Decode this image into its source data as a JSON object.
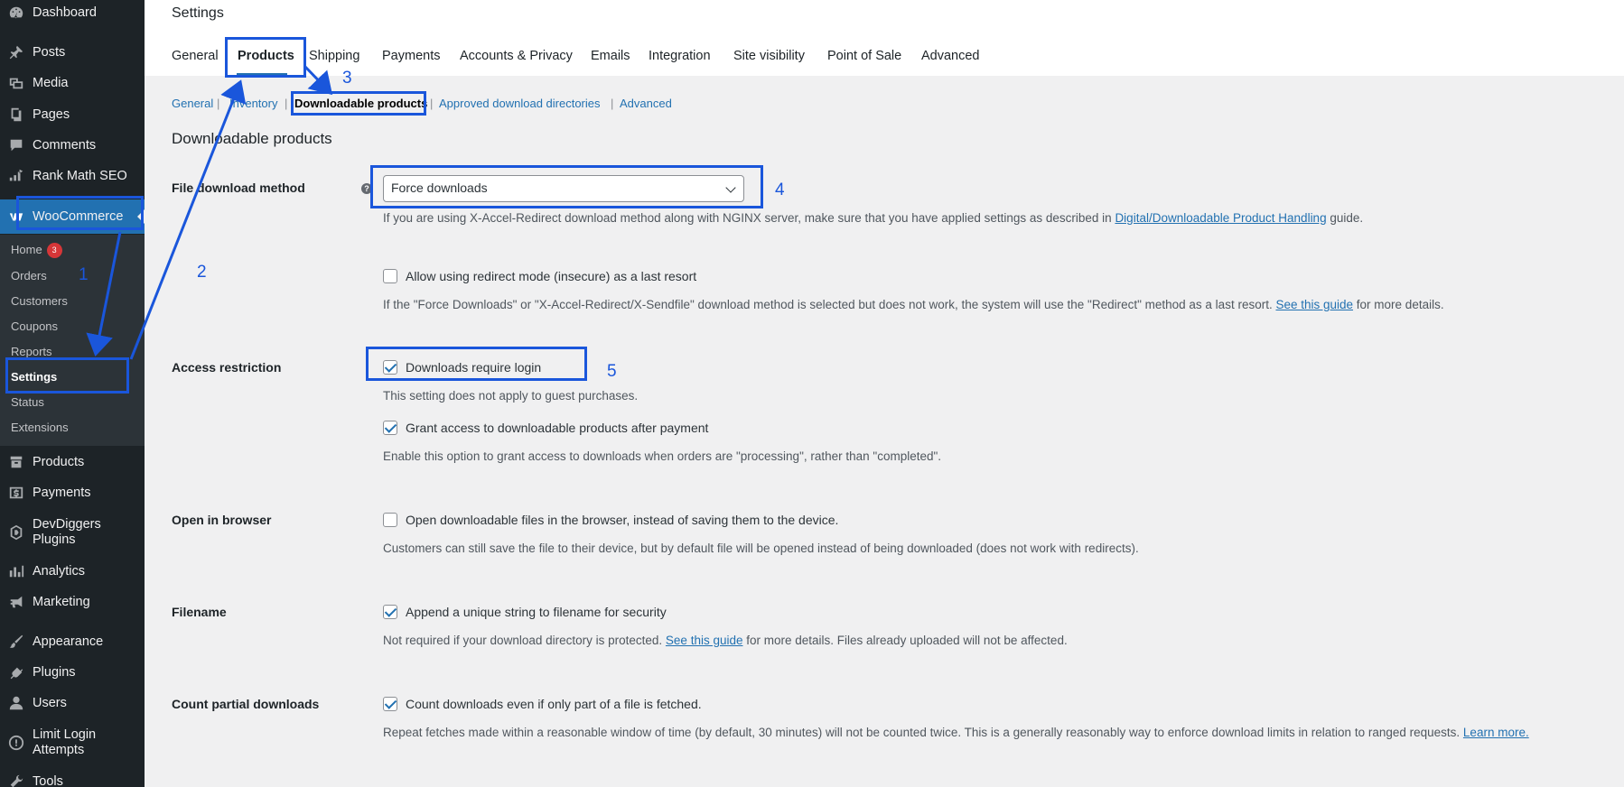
{
  "sidebar": {
    "items": [
      {
        "label": "Dashboard",
        "icon": "dashboard-icon"
      },
      {
        "label": "Posts",
        "icon": "pin-icon"
      },
      {
        "label": "Media",
        "icon": "media-icon"
      },
      {
        "label": "Pages",
        "icon": "pages-icon"
      },
      {
        "label": "Comments",
        "icon": "comment-icon"
      },
      {
        "label": "Rank Math SEO",
        "icon": "chart-icon"
      },
      {
        "label": "WooCommerce",
        "icon": "woo-icon"
      },
      {
        "label": "Products",
        "icon": "archive-icon"
      },
      {
        "label": "Payments",
        "icon": "dollar-icon"
      },
      {
        "label": "DevDiggers Plugins",
        "icon": "devdiggers-icon"
      },
      {
        "label": "Analytics",
        "icon": "bars-icon"
      },
      {
        "label": "Marketing",
        "icon": "megaphone-icon"
      },
      {
        "label": "Appearance",
        "icon": "brush-icon"
      },
      {
        "label": "Plugins",
        "icon": "plug-icon"
      },
      {
        "label": "Users",
        "icon": "user-icon"
      },
      {
        "label": "Limit Login Attempts",
        "icon": "limit-login-icon"
      },
      {
        "label": "Tools",
        "icon": "wrench-icon"
      }
    ],
    "submenu": [
      {
        "label": "Home",
        "badge": "3"
      },
      {
        "label": "Orders"
      },
      {
        "label": "Customers"
      },
      {
        "label": "Coupons"
      },
      {
        "label": "Reports"
      },
      {
        "label": "Settings"
      },
      {
        "label": "Status"
      },
      {
        "label": "Extensions"
      }
    ]
  },
  "header": {
    "title": "Settings",
    "tabs": [
      "General",
      "Products",
      "Shipping",
      "Payments",
      "Accounts & Privacy",
      "Emails",
      "Integration",
      "Site visibility",
      "Point of Sale",
      "Advanced"
    ],
    "active_tab": "Products"
  },
  "subnav": [
    "General",
    "Inventory",
    "Downloadable products",
    "Approved download directories",
    "Advanced"
  ],
  "section_title": "Downloadable products",
  "settings": {
    "file_download_method": {
      "label": "File download method",
      "value": "Force downloads",
      "desc_prefix": "If you are using X-Accel-Redirect download method along with NGINX server, make sure that you have applied settings as described in",
      "desc_link": "Digital/Downloadable Product Handling",
      "desc_suffix": "guide.",
      "redirect_label": "Allow using redirect mode (insecure) as a last resort",
      "redirect_checked": false,
      "redirect_desc_prefix": "If the \"Force Downloads\" or \"X-Accel-Redirect/X-Sendfile\" download method is selected but does not work, the system will use the \"Redirect\" method as a last resort.",
      "redirect_desc_link": "See this guide",
      "redirect_desc_suffix": "for more details."
    },
    "access_restriction": {
      "label": "Access restriction",
      "require_login_label": "Downloads require login",
      "require_login_checked": true,
      "require_login_desc": "This setting does not apply to guest purchases.",
      "grant_access_label": "Grant access to downloadable products after payment",
      "grant_access_checked": true,
      "grant_access_desc": "Enable this option to grant access to downloads when orders are \"processing\", rather than \"completed\"."
    },
    "open_in_browser": {
      "label": "Open in browser",
      "checkbox_label": "Open downloadable files in the browser, instead of saving them to the device.",
      "checked": false,
      "desc": "Customers can still save the file to their device, but by default file will be opened instead of being downloaded (does not work with redirects)."
    },
    "filename": {
      "label": "Filename",
      "checkbox_label": "Append a unique string to filename for security",
      "checked": true,
      "desc_prefix": "Not required if your download directory is protected.",
      "desc_link": "See this guide",
      "desc_suffix": "for more details. Files already uploaded will not be affected."
    },
    "count_partial": {
      "label": "Count partial downloads",
      "checkbox_label": "Count downloads even if only part of a file is fetched.",
      "checked": true,
      "desc_prefix": "Repeat fetches made within a reasonable window of time (by default, 30 minutes) will not be counted twice. This is a generally reasonably way to enforce download limits in relation to ranged requests.",
      "desc_link": "Learn more."
    }
  },
  "annotations": [
    "1",
    "2",
    "3",
    "4",
    "5"
  ],
  "colors": {
    "accent": "#2271b1",
    "annotation": "#1a56db",
    "sidebar_bg": "#1d2327"
  }
}
